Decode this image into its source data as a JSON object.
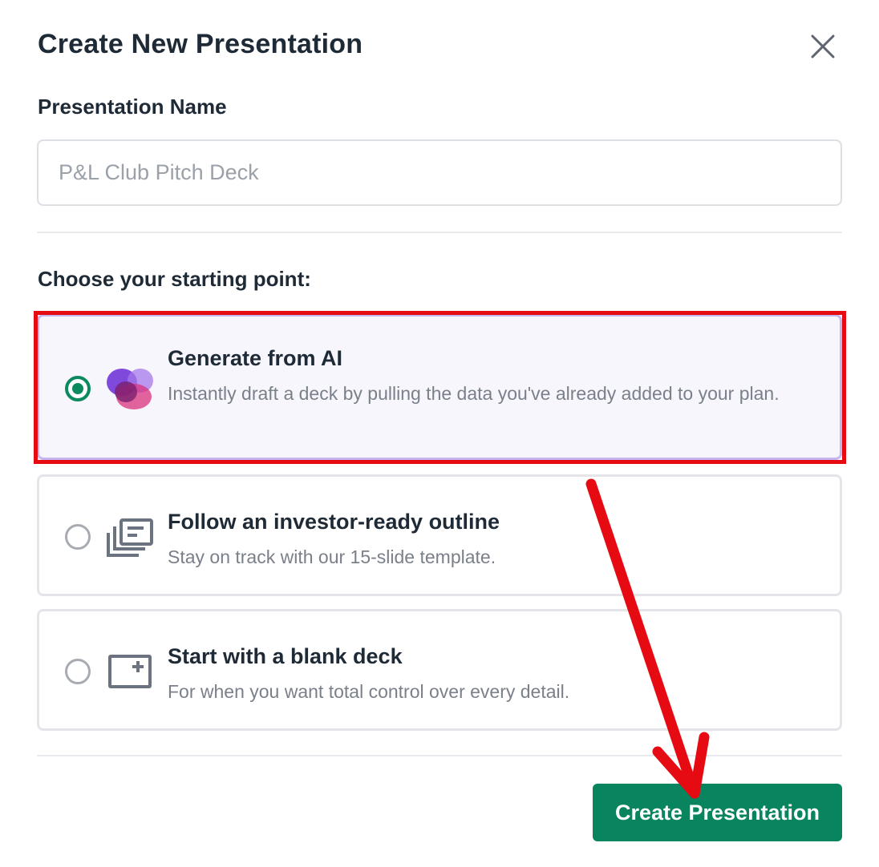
{
  "dialog": {
    "title": "Create New Presentation",
    "close_icon": "close-icon"
  },
  "name_field": {
    "label": "Presentation Name",
    "placeholder": "P&L Club Pitch Deck",
    "value": ""
  },
  "starting_point": {
    "label": "Choose your starting point:",
    "options": [
      {
        "title": "Generate from AI",
        "description": "Instantly draft a deck by pulling the data you've already added to your plan.",
        "icon": "ai-blob-icon",
        "selected": true
      },
      {
        "title": "Follow an investor-ready outline",
        "description": "Stay on track with our 15-slide template.",
        "icon": "outline-slides-icon",
        "selected": false
      },
      {
        "title": "Start with a blank deck",
        "description": "For when you want total control over every detail.",
        "icon": "blank-deck-icon",
        "selected": false
      }
    ]
  },
  "footer": {
    "create_label": "Create Presentation"
  },
  "colors": {
    "accent_green": "#08855e",
    "annotation_red": "#e60b12",
    "selected_bg": "#f8f6fd"
  }
}
